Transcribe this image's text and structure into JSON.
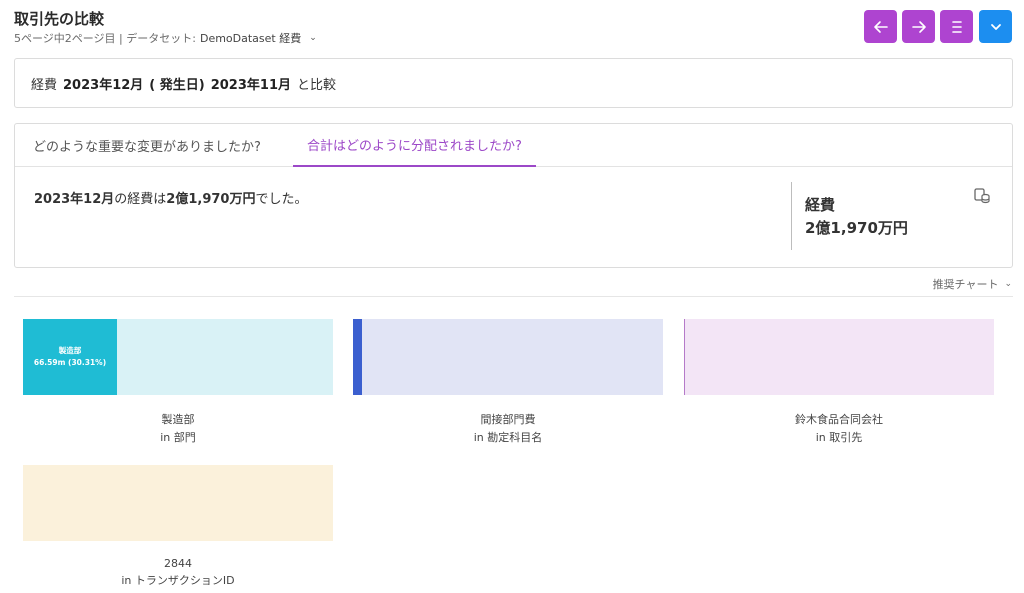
{
  "header": {
    "title": "取引先の比較",
    "subtitle_page": "5ページ中2ページ目 | データセット:",
    "dataset": "DemoDataset 経費"
  },
  "toolbar": {
    "colors": {
      "purple": "#ae44d0",
      "blue": "#1c8ef0"
    },
    "buttons": [
      {
        "icon": "arrow-left-icon"
      },
      {
        "icon": "arrow-right-icon"
      },
      {
        "icon": "menu-icon"
      },
      {
        "icon": "chevron-down-icon"
      }
    ]
  },
  "compare": {
    "metric": "経費",
    "period": "2023年12月",
    "period_note": "( 発生日)",
    "compare_period": "2023年11月",
    "compare_suffix": "と比較"
  },
  "tabs": [
    {
      "label": "どのような重要な変更がありましたか?",
      "active": false
    },
    {
      "label": "合計はどのように分配されましたか?",
      "active": true
    }
  ],
  "summary": {
    "period": "2023年12月",
    "mid": "の経費は",
    "amount": "2億1,970万円",
    "tail": "でした。"
  },
  "kpi": {
    "label": "経費",
    "value": "2億1,970万円"
  },
  "chart_selector": {
    "label": "推奨チャート"
  },
  "cards": [
    {
      "name": "製造部",
      "dimension": "in 部門",
      "fill_label": "製造部",
      "fill_value": "66.59m (30.31%)",
      "share": 0.3031,
      "fill_color": "#1fbcd4",
      "bg_color": "#d9f2f6"
    },
    {
      "name": "間接部門費",
      "dimension": "in 勘定科目名",
      "share": 0.03,
      "fill_color": "#3b5fcf",
      "bg_color": "#e1e4f5"
    },
    {
      "name": "鈴木食品合同会社",
      "dimension": "in 取引先",
      "share": 0.003,
      "fill_color": "#b57ac9",
      "bg_color": "#f3e5f6"
    },
    {
      "name": "2844",
      "dimension": "in トランザクションID",
      "share": 0.0,
      "fill_color": "#e8d9ad",
      "bg_color": "#fbf1db"
    }
  ]
}
